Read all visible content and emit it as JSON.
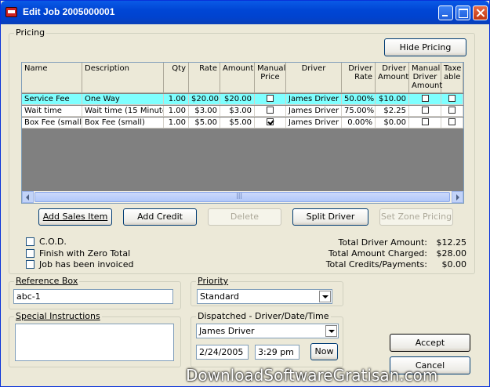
{
  "window": {
    "title": "Edit Job 2005000001"
  },
  "pricing": {
    "legend": "Pricing",
    "hide_pricing_label": "Hide Pricing",
    "columns": [
      "Name",
      "Description",
      "Qty",
      "Rate",
      "Amount",
      "Manual Price",
      "Driver",
      "Driver Rate",
      "Driver Amount",
      "Manual Driver Amount",
      "Taxable"
    ],
    "header_lines": {
      "manual_price": [
        "Manual",
        "Price"
      ],
      "driver_rate": [
        "Driver",
        "Rate"
      ],
      "driver_amount": [
        "Driver",
        "Amount"
      ],
      "manual_driver_amount": [
        "Manual",
        "Driver",
        "Amount"
      ],
      "taxable": [
        "Taxe",
        "able"
      ]
    },
    "rows": [
      {
        "name": "Service Fee",
        "description": "One Way",
        "qty": "1.00",
        "rate": "$20.00",
        "amount": "$20.00",
        "manual_price": false,
        "driver": "James Driver",
        "driver_rate": "50.00%",
        "driver_amount": "$10.00",
        "manual_driver_amount": false,
        "taxable": false
      },
      {
        "name": "Wait time",
        "description": "Wait time (15 Minutes)",
        "qty": "1.00",
        "rate": "$3.00",
        "amount": "$3.00",
        "manual_price": false,
        "driver": "James Driver",
        "driver_rate": "75.00%",
        "driver_amount": "$2.25",
        "manual_driver_amount": false,
        "taxable": false
      },
      {
        "name": "Box Fee (small)",
        "description": "Box Fee (small)",
        "qty": "1.00",
        "rate": "$5.00",
        "amount": "$5.00",
        "manual_price": true,
        "driver": "James Driver",
        "driver_rate": "0.00%",
        "driver_amount": "$0.00",
        "manual_driver_amount": false,
        "taxable": false
      }
    ],
    "scroll_grip": "|||",
    "buttons": {
      "add_sales_item": "Add Sales Item",
      "add_credit": "Add Credit",
      "delete": "Delete",
      "split_driver": "Split Driver",
      "set_zone_pricing": "Set Zone Pricing"
    },
    "checkboxes": {
      "cod": "C.O.D.",
      "finish_zero": "Finish with Zero Total",
      "invoiced": "Job has been invoiced"
    },
    "totals": {
      "driver_label": "Total Driver Amount:",
      "driver_value": "$12.25",
      "charged_label": "Total Amount Charged:",
      "charged_value": "$28.00",
      "credits_label": "Total Credits/Payments:",
      "credits_value": "$0.00"
    }
  },
  "reference": {
    "legend": "Reference Box",
    "value": "abc-1"
  },
  "priority": {
    "legend": "Priority",
    "value": "Standard"
  },
  "special": {
    "legend": "Special Instructions",
    "value": ""
  },
  "dispatched": {
    "legend": "Dispatched - Driver/Date/Time",
    "driver": "James Driver",
    "date": "2/24/2005",
    "time": "3:29 pm",
    "now_label": "Now"
  },
  "actions": {
    "accept_label": "Accept",
    "cancel_label": "Cancel"
  },
  "watermark": "DownloadSoftwareGratisan.com"
}
